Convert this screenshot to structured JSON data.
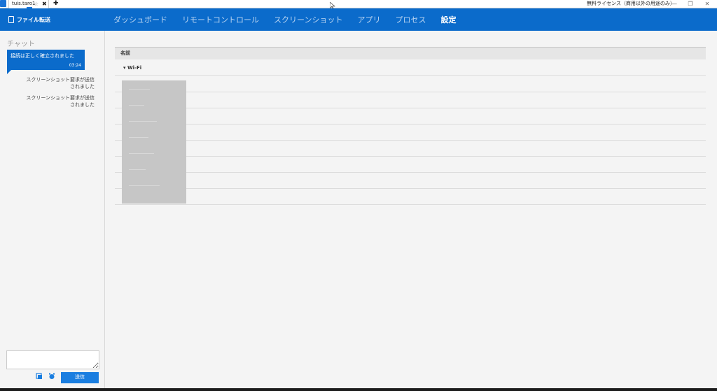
{
  "titlebar": {
    "tab_label": "tuis.taro1",
    "star_glyph": "☆",
    "close_glyph": "✖",
    "new_tab_glyph": "✚",
    "license_text": "無料ライセンス（商用以外の用途のみ）",
    "minimize_glyph": "—",
    "restore_glyph": "❐",
    "close_window_glyph": "✕"
  },
  "nav": {
    "file_transfer_label": "ファイル転送",
    "items": [
      {
        "label": "ダッシュボード",
        "active": false
      },
      {
        "label": "リモートコントロール",
        "active": false
      },
      {
        "label": "スクリーンショット",
        "active": false
      },
      {
        "label": "アプリ",
        "active": false
      },
      {
        "label": "プロセス",
        "active": false
      },
      {
        "label": "設定",
        "active": true
      }
    ]
  },
  "chat": {
    "title": "チャット",
    "bubble": {
      "text": "接続は正しく確立されました",
      "time": "03:24"
    },
    "messages": [
      {
        "line1": "スクリーンショット要求が送信",
        "line2": "されました"
      },
      {
        "line1": "スクリーンショット要求が送信",
        "line2": "されました"
      }
    ],
    "input_value": "",
    "send_label": "送信"
  },
  "table": {
    "header_name": "名前",
    "group_toggle": "▾",
    "group_label": "Wi-Fi"
  },
  "colors": {
    "accent": "#0b6bcb",
    "send": "#1a7ee0",
    "background": "#f4f4f4"
  }
}
